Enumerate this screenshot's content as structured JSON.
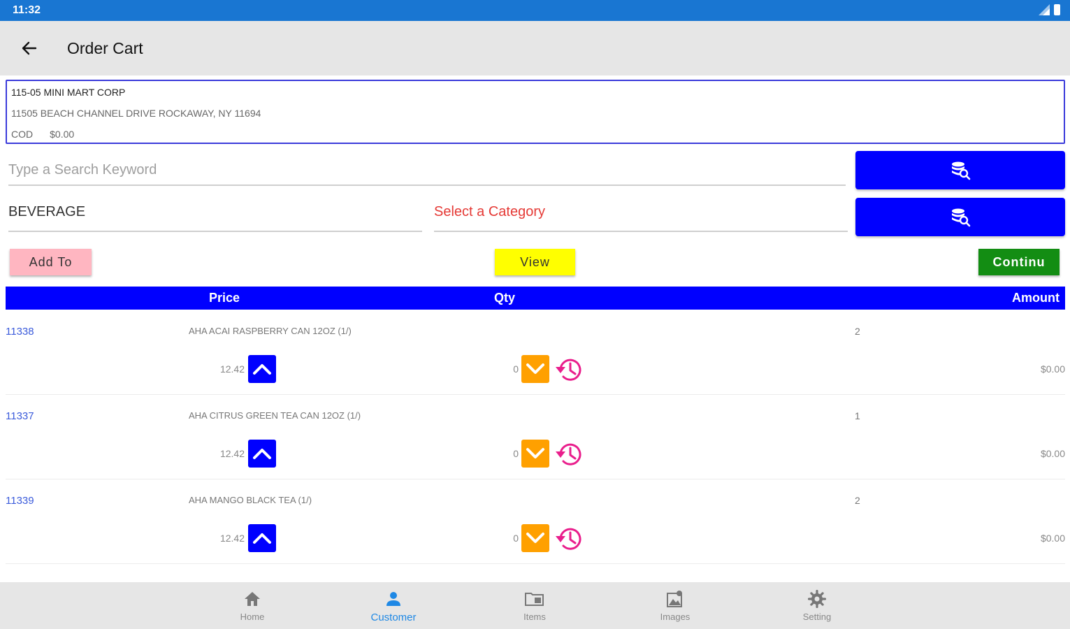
{
  "status_bar": {
    "time": "11:32"
  },
  "app_bar": {
    "title": "Order Cart"
  },
  "customer": {
    "name": "115-05 MINI MART CORP",
    "address": "11505 BEACH CHANNEL DRIVE ROCKAWAY, NY 11694",
    "terms": "COD",
    "balance": "$0.00"
  },
  "search": {
    "placeholder": "Type a Search Keyword",
    "value": ""
  },
  "filters": {
    "department": "BEVERAGE",
    "category_placeholder": "Select a Category"
  },
  "actions": {
    "add_label": "Add To",
    "view_label": "View",
    "continue_label": "Continu"
  },
  "table": {
    "headers": {
      "price": "Price",
      "qty": "Qty",
      "amount": "Amount"
    },
    "rows": [
      {
        "code": "11338",
        "description": "AHA ACAI RASPBERRY CAN 12OZ (1/)",
        "cases": "2",
        "price": "12.42",
        "qty": "0",
        "amount": "$0.00"
      },
      {
        "code": "11337",
        "description": "AHA CITRUS GREEN TEA CAN 12OZ (1/)",
        "cases": "1",
        "price": "12.42",
        "qty": "0",
        "amount": "$0.00"
      },
      {
        "code": "11339",
        "description": "AHA MANGO BLACK TEA (1/)",
        "cases": "2",
        "price": "12.42",
        "qty": "0",
        "amount": "$0.00"
      }
    ]
  },
  "bottom_nav": {
    "items": [
      {
        "label": "Home",
        "icon": "home-icon",
        "active": false
      },
      {
        "label": "Customer",
        "icon": "person-icon",
        "active": true
      },
      {
        "label": "Items",
        "icon": "folder-icon",
        "active": false
      },
      {
        "label": "Images",
        "icon": "images-icon",
        "active": false
      },
      {
        "label": "Setting",
        "icon": "gear-icon",
        "active": false
      }
    ]
  },
  "colors": {
    "status_bar": "#1976d2",
    "primary_blue": "#0000ff",
    "add_button": "#ffb6c1",
    "view_button": "#ffff00",
    "continue_button": "#138d13",
    "down_button": "#ffa000",
    "history_icon": "#e91e8c",
    "category_text": "#e53935",
    "active_nav": "#1e88e5"
  }
}
